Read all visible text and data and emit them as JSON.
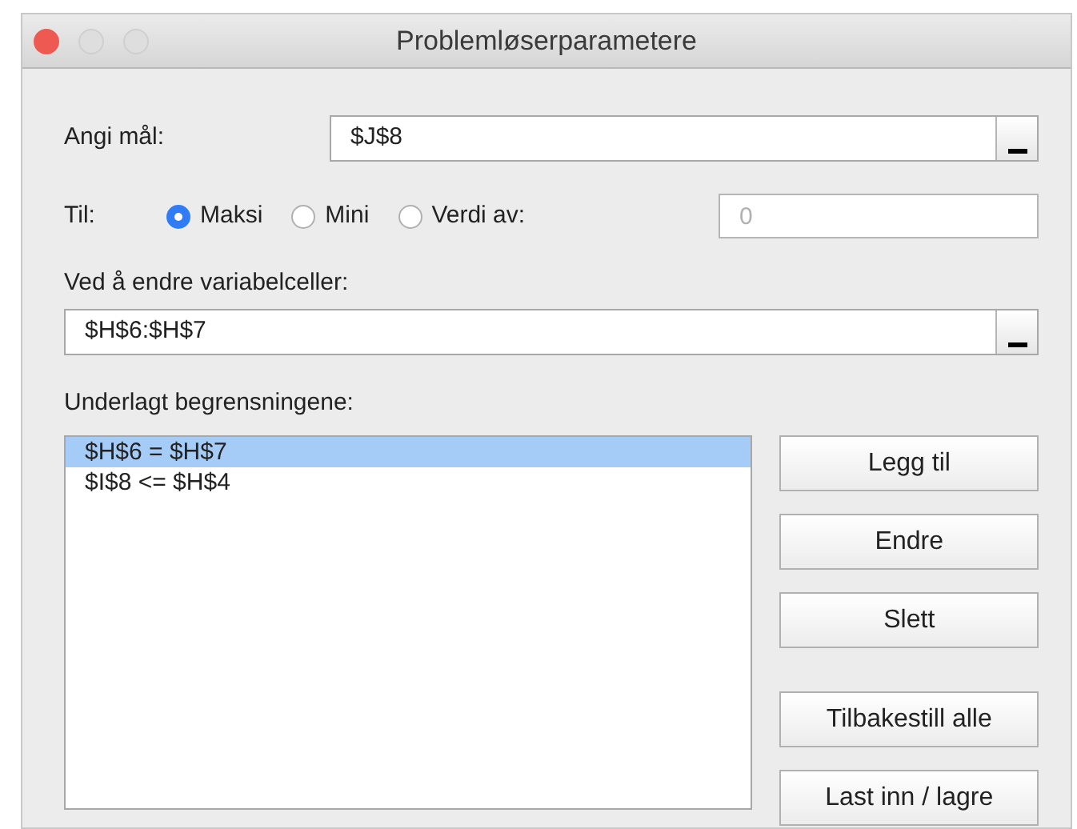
{
  "window": {
    "title": "Problemløserparametere"
  },
  "objective": {
    "label": "Angi mål:",
    "value": "$J$8"
  },
  "to": {
    "label": "Til:",
    "options": [
      {
        "label": "Maksi",
        "selected": true
      },
      {
        "label": "Mini",
        "selected": false
      },
      {
        "label": "Verdi av:",
        "selected": false
      }
    ],
    "value_placeholder": "0"
  },
  "variables": {
    "label": "Ved å endre variabelceller:",
    "value": "$H$6:$H$7"
  },
  "constraints": {
    "label": "Underlagt begrensningene:",
    "items": [
      {
        "text": "$H$6 = $H$7",
        "selected": true
      },
      {
        "text": "$I$8 <= $H$4",
        "selected": false
      }
    ]
  },
  "edit_buttons": [
    "Legg til",
    "Endre",
    "Slett"
  ],
  "file_buttons": [
    "Tilbakestill alle",
    "Last inn / lagre"
  ]
}
